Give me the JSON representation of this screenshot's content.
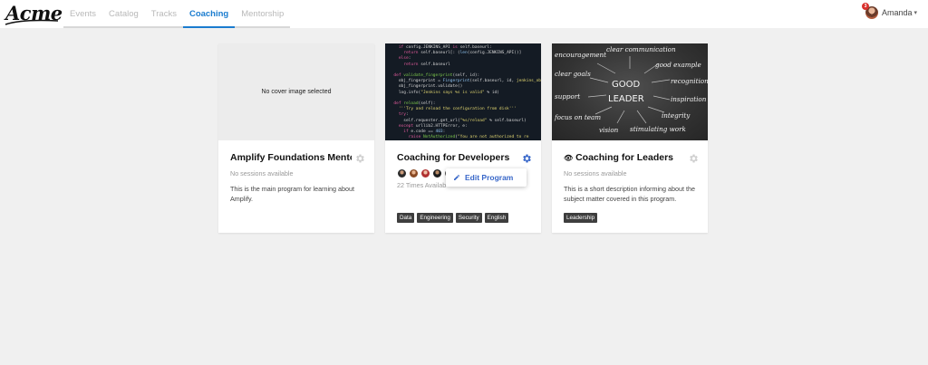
{
  "brand": {
    "logo_text": "Acme"
  },
  "nav": {
    "tabs": [
      {
        "label": "Events"
      },
      {
        "label": "Catalog"
      },
      {
        "label": "Tracks"
      },
      {
        "label": "Coaching"
      },
      {
        "label": "Mentorship"
      }
    ],
    "active_tab": "Coaching"
  },
  "user": {
    "name": "Amanda",
    "notification_count": "3"
  },
  "cards": [
    {
      "cover_text": "No cover image selected",
      "title": "Amplify Foundations Mento...",
      "subtitle": "No sessions available",
      "description": "This is the main program for learning about Amplify.",
      "tags": []
    },
    {
      "title": "Coaching for Developers",
      "subtitle": "22 Times Availab",
      "description": "",
      "tags": [
        "Data",
        "Engineering",
        "Security",
        "English"
      ],
      "menu_item": "Edit Program"
    },
    {
      "title": "Coaching for Leaders",
      "subtitle": "No sessions available",
      "description": "This is a short description informing about the subject matter covered in this program.",
      "tags": [
        "Leadership"
      ],
      "chalkboard_words": [
        "clear communication",
        "encouragement",
        "good example",
        "clear goals",
        "GOOD",
        "recognition",
        "support",
        "LEADER",
        "inspiration",
        "focus on team",
        "integrity",
        "vision",
        "stimulating work"
      ]
    }
  ],
  "colors": {
    "accent": "#1a7ccf",
    "tag_bg": "#3e3e3e",
    "popup_text": "#3867c9"
  }
}
